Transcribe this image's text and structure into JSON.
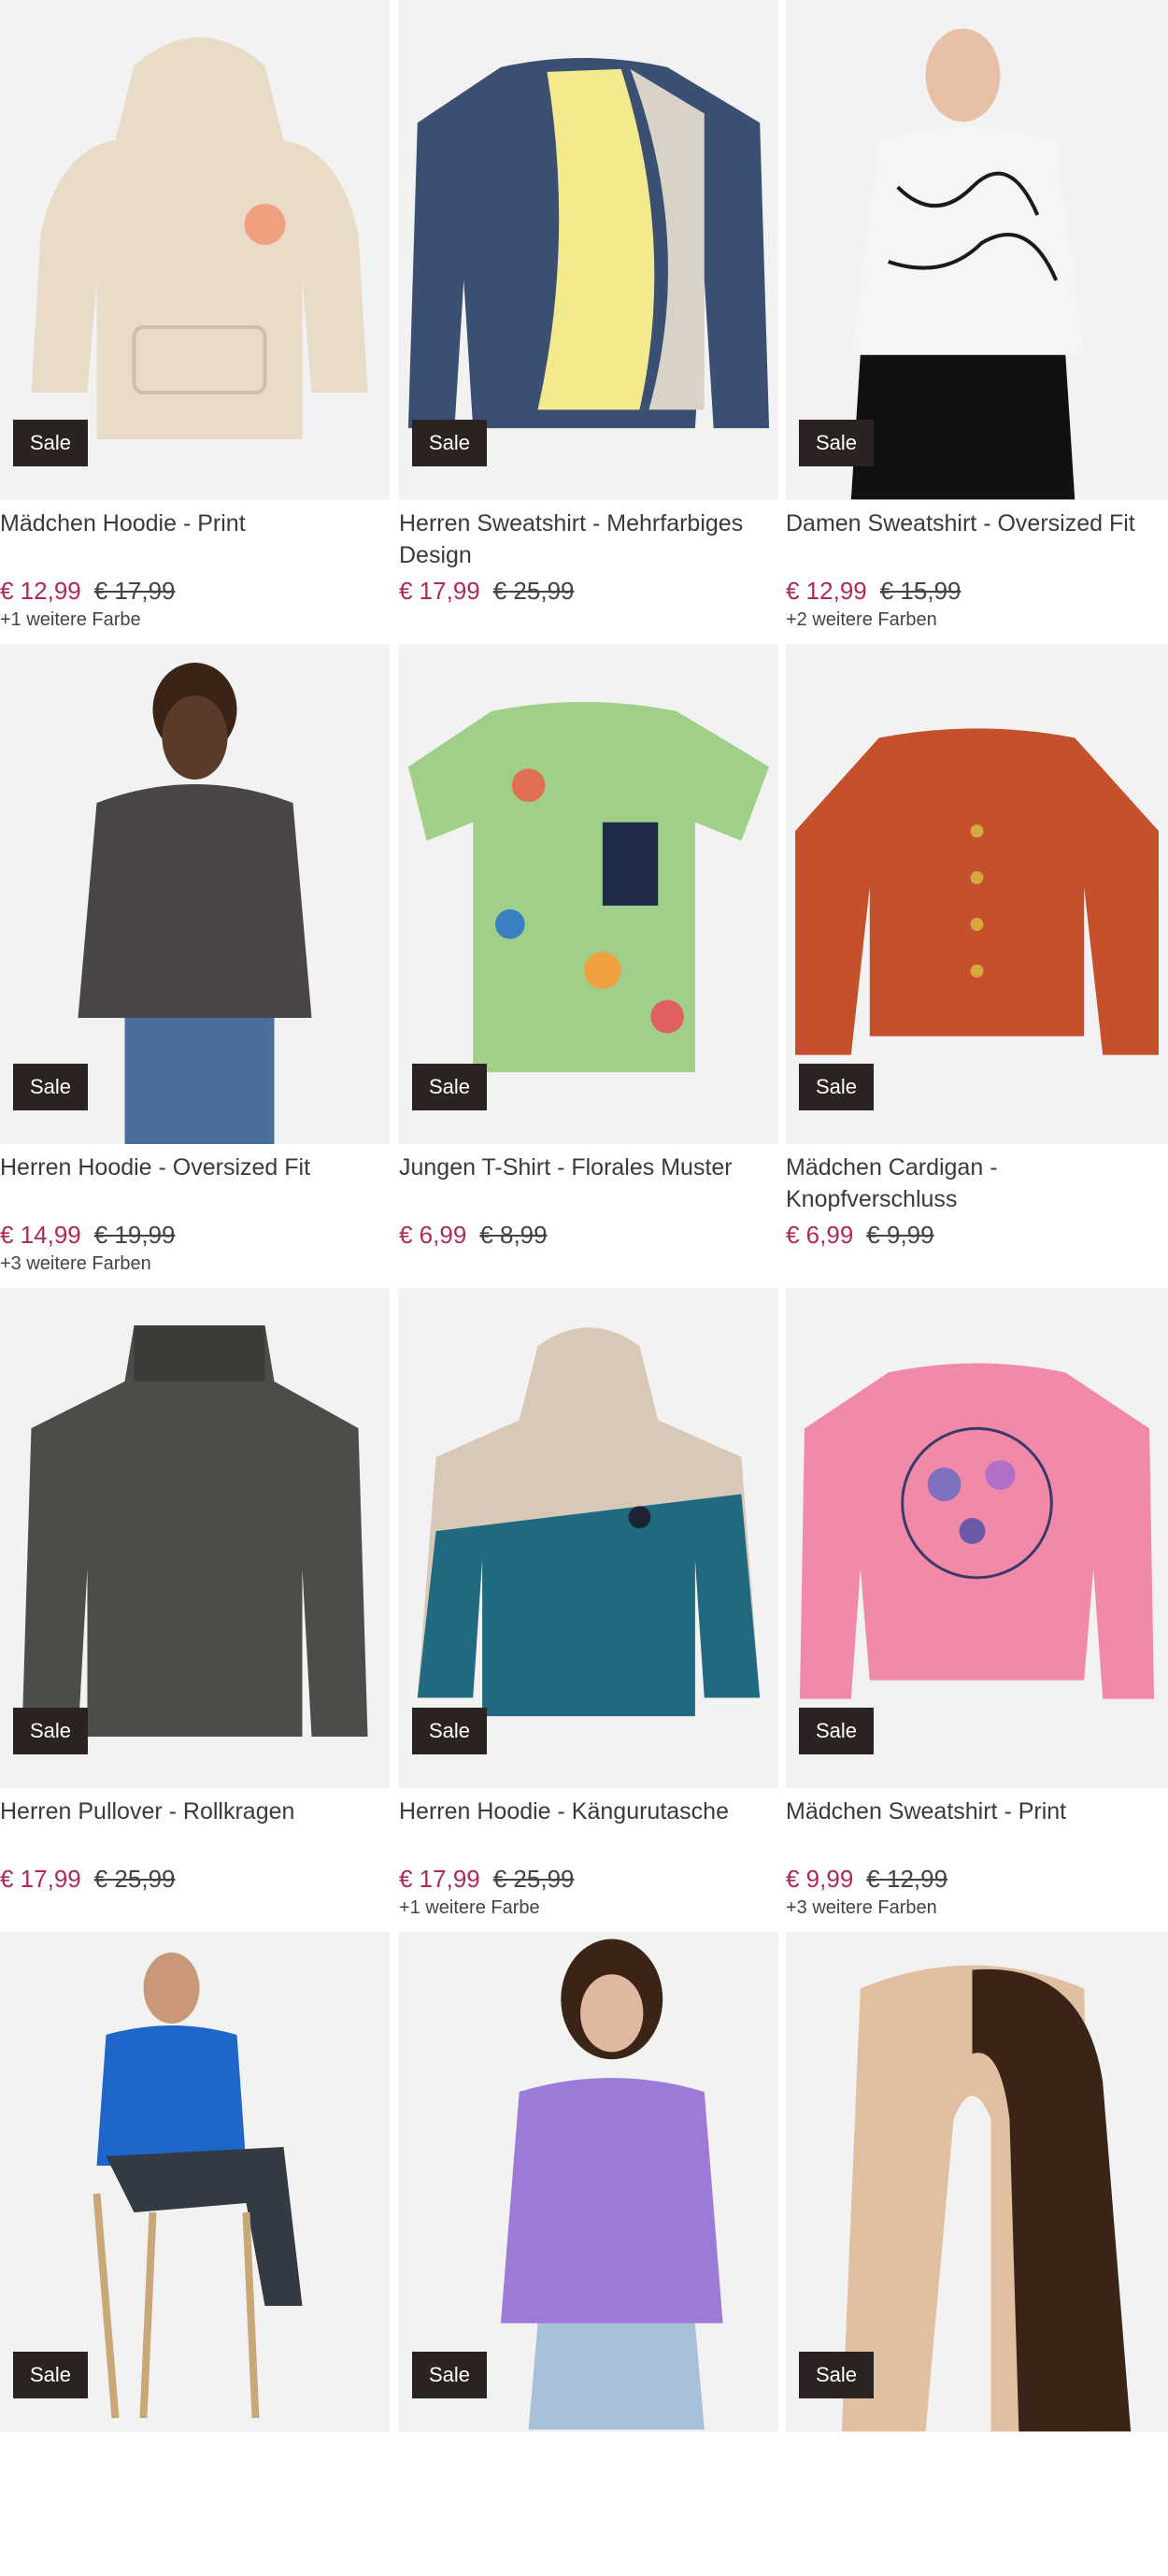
{
  "products": [
    {
      "title": "Mädchen Hoodie - Print",
      "badge": "Sale",
      "price": "€ 12,99",
      "old_price": "€ 17,99",
      "colors": "+1 weitere Farbe",
      "garment": "hoodie",
      "fill": "#e8dcc8",
      "accent": "#f0a080"
    },
    {
      "title": "Herren Sweatshirt - Mehrfarbiges Design",
      "badge": "Sale",
      "price": "€ 17,99",
      "old_price": "€ 25,99",
      "colors": "",
      "garment": "sweatshirt-multi",
      "fill": "#3a4f72",
      "accent": "#f2ea8c"
    },
    {
      "title": "Damen Sweatshirt - Oversized Fit",
      "badge": "Sale",
      "price": "€ 12,99",
      "old_price": "€ 15,99",
      "colors": "+2 weitere Farben",
      "garment": "model-white",
      "fill": "#f5f5f5",
      "accent": "#1a1a1a"
    },
    {
      "title": "Herren Hoodie - Oversized Fit",
      "badge": "Sale",
      "price": "€ 14,99",
      "old_price": "€ 19,99",
      "colors": "+3 weitere Farben",
      "garment": "model-hoodie",
      "fill": "#4a4648",
      "accent": "#4a6f9a"
    },
    {
      "title": "Jungen T-Shirt - Florales Muster",
      "badge": "Sale",
      "price": "€ 6,99",
      "old_price": "€ 8,99",
      "colors": "",
      "garment": "tshirt-floral",
      "fill": "#9fcf88",
      "accent": "#1d2a48"
    },
    {
      "title": "Mädchen Cardigan - Knopfverschluss",
      "badge": "Sale",
      "price": "€ 6,99",
      "old_price": "€ 9,99",
      "colors": "",
      "garment": "cardigan",
      "fill": "#c4502c",
      "accent": "#d8a840"
    },
    {
      "title": "Herren Pullover - Rollkragen",
      "badge": "Sale",
      "price": "€ 17,99",
      "old_price": "€ 25,99",
      "colors": "",
      "garment": "turtleneck",
      "fill": "#4a4d48",
      "accent": "#3a3c38"
    },
    {
      "title": "Herren Hoodie - Kängurutasche",
      "badge": "Sale",
      "price": "€ 17,99",
      "old_price": "€ 25,99",
      "colors": "+1 weitere Farbe",
      "garment": "hoodie-block",
      "fill": "#1f6a80",
      "accent": "#d8c8b8"
    },
    {
      "title": "Mädchen Sweatshirt - Print",
      "badge": "Sale",
      "price": "€ 9,99",
      "old_price": "€ 12,99",
      "colors": "+3 weitere Farben",
      "garment": "sweatshirt-pink",
      "fill": "#f08aa8",
      "accent": "#3a3a6a"
    },
    {
      "title": "",
      "badge": "Sale",
      "price": "",
      "old_price": "",
      "colors": "",
      "garment": "model-seated",
      "fill": "#1e66c8",
      "accent": "#333a44"
    },
    {
      "title": "",
      "badge": "Sale",
      "price": "",
      "old_price": "",
      "colors": "",
      "garment": "model-lilac",
      "fill": "#9c7ad8",
      "accent": "#a8c0d8"
    },
    {
      "title": "",
      "badge": "Sale",
      "price": "",
      "old_price": "",
      "colors": "",
      "garment": "scarf",
      "fill": "#e0c0a0",
      "accent": "#3a2418"
    }
  ]
}
